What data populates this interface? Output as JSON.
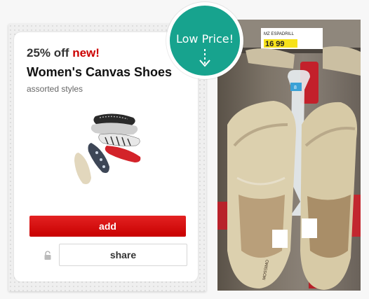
{
  "card": {
    "discount_text": "25% off",
    "new_text": "new!",
    "title": "Women's Canvas Shoes",
    "subtitle": "assorted styles",
    "add_label": "add",
    "share_label": "share"
  },
  "badge": {
    "text": "Low Price!"
  },
  "photo": {
    "tag_brand": "MZ ESPADRILL",
    "tag_price": "16 99",
    "hanger_number": "8",
    "insole_brand": "MOSSIMO"
  },
  "colors": {
    "brand_red": "#cc0000",
    "badge_teal": "#17a38e"
  },
  "icons": {
    "lock": "lock-icon",
    "arrow": "arrow-down-icon"
  }
}
